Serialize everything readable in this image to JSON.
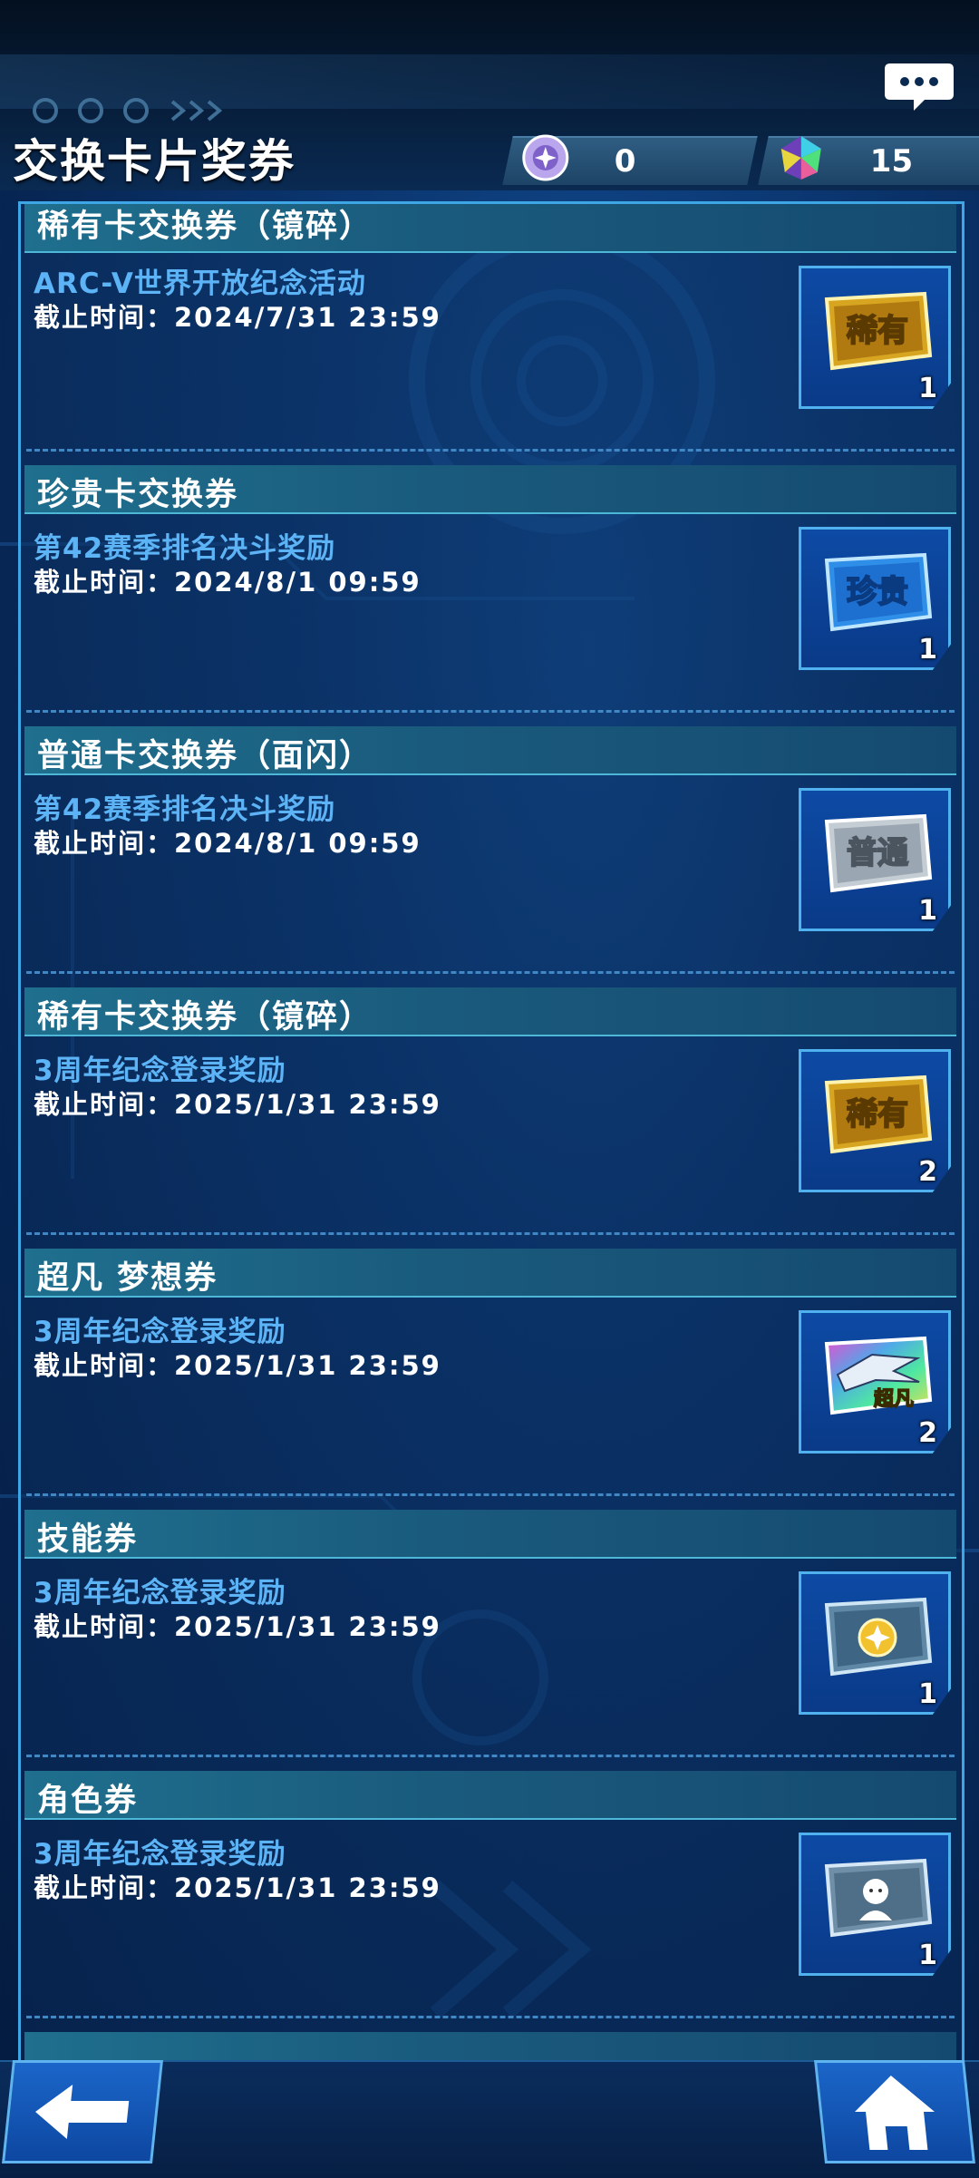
{
  "header": {
    "title": "交换卡片奖券",
    "currencies": [
      {
        "icon": "orb-icon",
        "value": "0"
      },
      {
        "icon": "gem-icon",
        "value": "15"
      }
    ]
  },
  "tickets": [
    {
      "name": "稀有卡交换券（镜碎）",
      "source": "ARC-V世界开放纪念活动",
      "deadline": "截止时间：2024/7/31 23:59",
      "badge": "稀有",
      "count": "1",
      "kind": "rare"
    },
    {
      "name": "珍贵卡交换券",
      "source": "第42赛季排名决斗奖励",
      "deadline": "截止时间：2024/8/1 09:59",
      "badge": "珍贵",
      "count": "1",
      "kind": "precious"
    },
    {
      "name": "普通卡交换券（面闪）",
      "source": "第42赛季排名决斗奖励",
      "deadline": "截止时间：2024/8/1 09:59",
      "badge": "普通",
      "count": "1",
      "kind": "normal"
    },
    {
      "name": "稀有卡交换券（镜碎）",
      "source": "3周年纪念登录奖励",
      "deadline": "截止时间：2025/1/31 23:59",
      "badge": "稀有",
      "count": "2",
      "kind": "rare"
    },
    {
      "name": "超凡 梦想券",
      "source": "3周年纪念登录奖励",
      "deadline": "截止时间：2025/1/31 23:59",
      "badge": "超凡",
      "count": "2",
      "kind": "dream"
    },
    {
      "name": "技能券",
      "source": "3周年纪念登录奖励",
      "deadline": "截止时间：2025/1/31 23:59",
      "badge": "",
      "count": "1",
      "kind": "skill"
    },
    {
      "name": "角色券",
      "source": "3周年纪念登录奖励",
      "deadline": "截止时间：2025/1/31 23:59",
      "badge": "",
      "count": "1",
      "kind": "character"
    }
  ],
  "colors": {
    "accent": "#3fa6e6",
    "source_text": "#5cb3f5",
    "header_band": "#1f6f8e"
  }
}
